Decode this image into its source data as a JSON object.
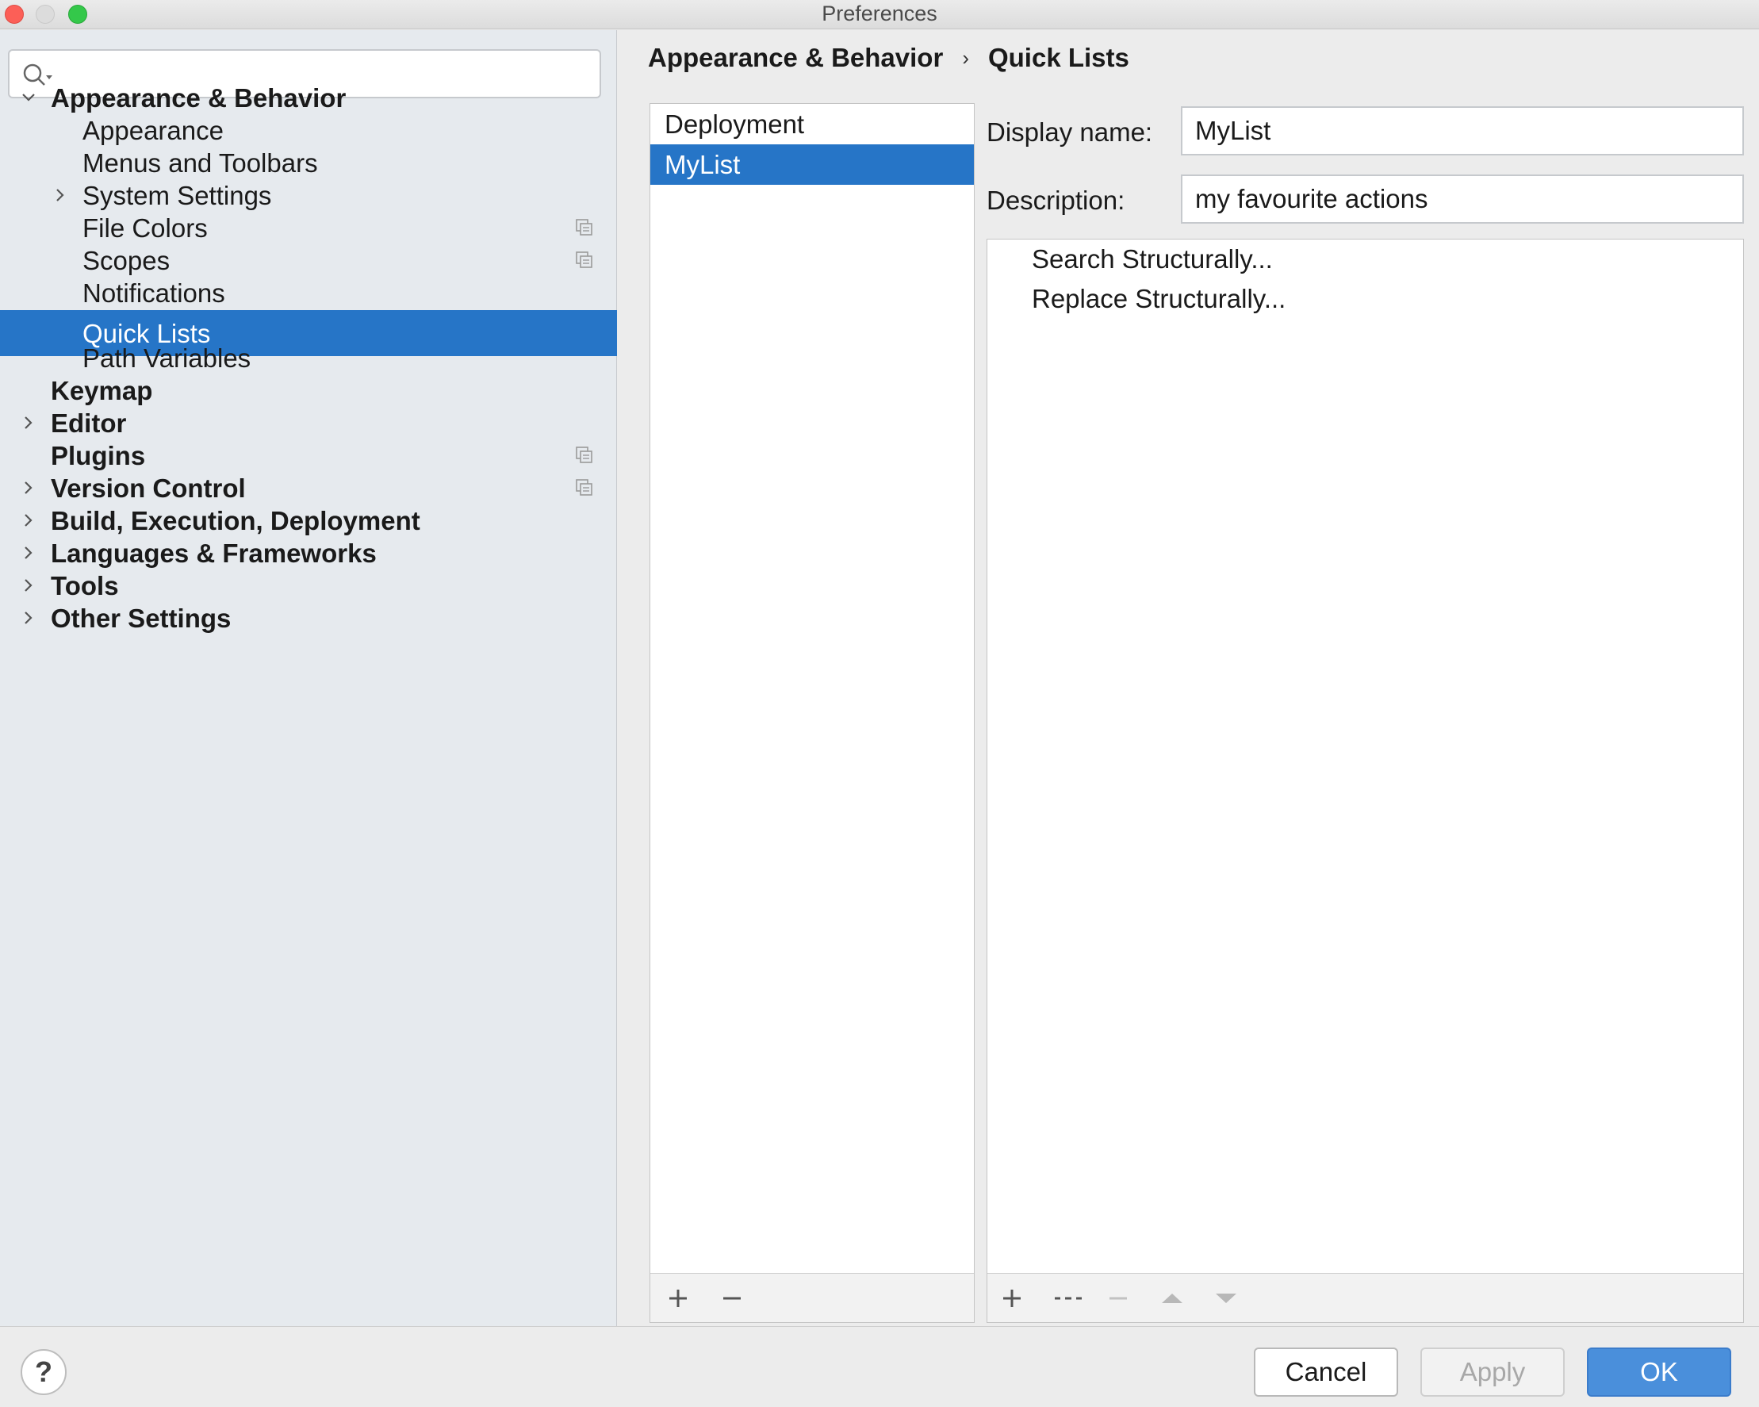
{
  "window": {
    "title": "Preferences"
  },
  "search": {
    "value": "",
    "placeholder": ""
  },
  "sidebar": {
    "items": [
      {
        "label": "Appearance & Behavior"
      },
      {
        "label": "Appearance"
      },
      {
        "label": "Menus and Toolbars"
      },
      {
        "label": "System Settings"
      },
      {
        "label": "File Colors"
      },
      {
        "label": "Scopes"
      },
      {
        "label": "Notifications"
      },
      {
        "label": "Quick Lists"
      },
      {
        "label": "Path Variables"
      },
      {
        "label": "Keymap"
      },
      {
        "label": "Editor"
      },
      {
        "label": "Plugins"
      },
      {
        "label": "Version Control"
      },
      {
        "label": "Build, Execution, Deployment"
      },
      {
        "label": "Languages & Frameworks"
      },
      {
        "label": "Tools"
      },
      {
        "label": "Other Settings"
      }
    ],
    "selected": "Quick Lists"
  },
  "breadcrumb": {
    "parent": "Appearance & Behavior",
    "separator": "›",
    "current": "Quick Lists"
  },
  "quick_lists": {
    "items": [
      "Deployment",
      "MyList"
    ],
    "selected": "MyList"
  },
  "form": {
    "display_name_label": "Display name:",
    "display_name_value": "MyList",
    "description_label": "Description:",
    "description_value": "my favourite actions"
  },
  "actions": {
    "items": [
      "Search Structurally...",
      "Replace Structurally..."
    ]
  },
  "buttons": {
    "help": "?",
    "cancel": "Cancel",
    "apply": "Apply",
    "ok": "OK"
  },
  "colors": {
    "selection": "#2675c7",
    "ok_button": "#4a8fdb",
    "sidebar_bg": "#e6eaee"
  }
}
